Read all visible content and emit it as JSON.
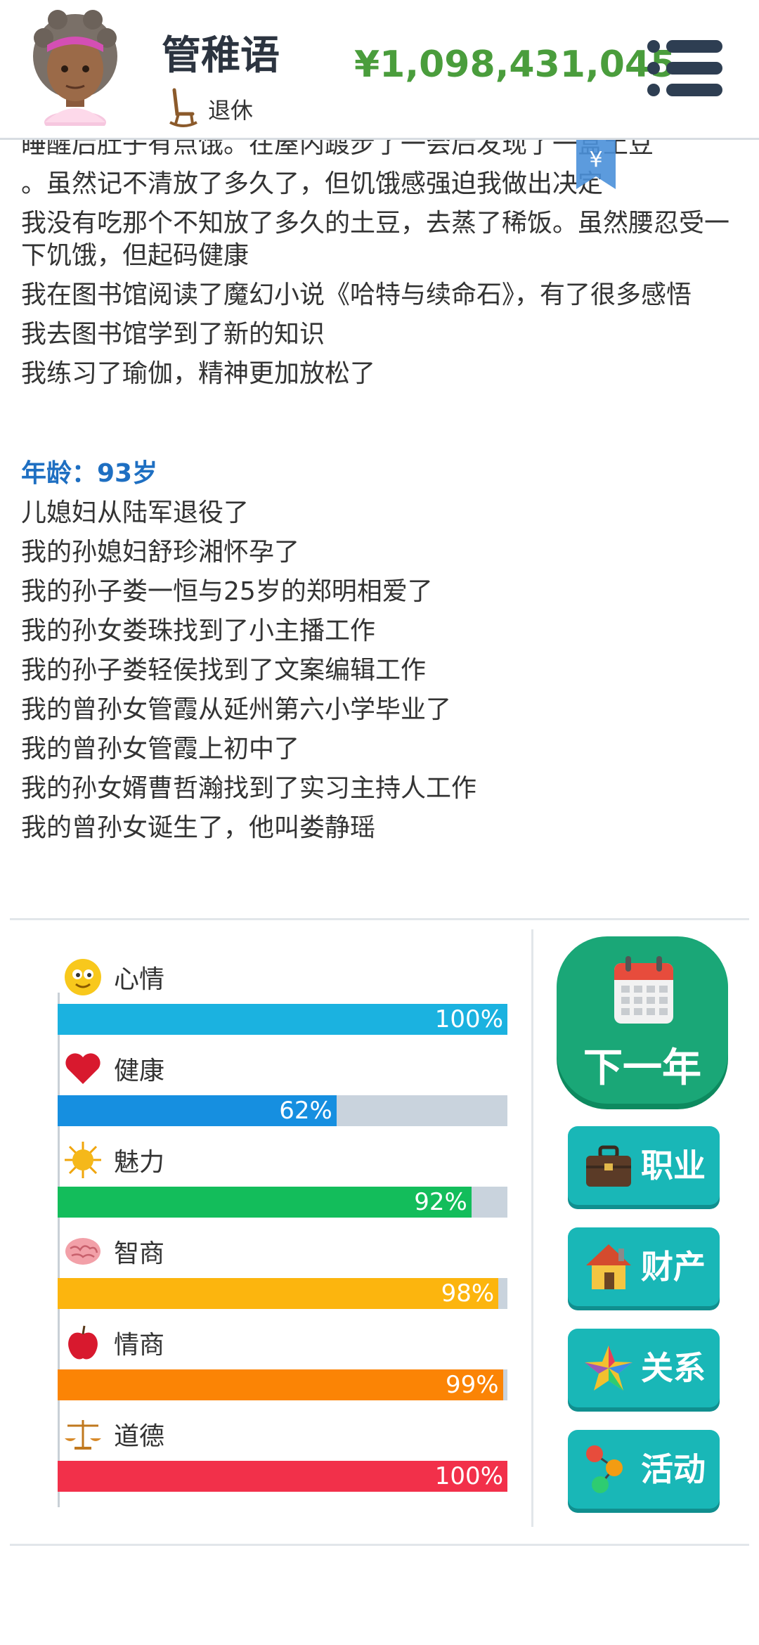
{
  "header": {
    "name": "管稚语",
    "status": "退休",
    "money": "¥1,098,431,045"
  },
  "tip_badge": "¥",
  "log": [
    {
      "text": "睡醒后肚子有点饿。在屋内踱步了一会后发现了一盒土豆"
    },
    {
      "text": "。虽然记不清放了多久了，但饥饿感强迫我做出决定"
    },
    {
      "text": "我没有吃那个不知放了多久的土豆，去蒸了稀饭。虽然腰忍受一下饥饿，但起码健康"
    },
    {
      "text": "我在图书馆阅读了魔幻小说《哈特与续命石》，有了很多感悟"
    },
    {
      "text": "我去图书馆学到了新的知识"
    },
    {
      "text": "我练习了瑜伽，精神更加放松了"
    },
    {
      "text": "年龄：93岁",
      "year": true
    },
    {
      "text": "儿媳妇从陆军退役了"
    },
    {
      "text": "我的孙媳妇舒珍湘怀孕了"
    },
    {
      "text": "我的孙子娄一恒与25岁的郑明相爱了"
    },
    {
      "text": "我的孙女娄珠找到了小主播工作"
    },
    {
      "text": "我的孙子娄轻侯找到了文案编辑工作"
    },
    {
      "text": "我的曾孙女管霞从延州第六小学毕业了"
    },
    {
      "text": "我的曾孙女管霞上初中了"
    },
    {
      "text": "我的孙女婿曹哲瀚找到了实习主持人工作"
    },
    {
      "text": "我的曾孙女诞生了，他叫娄静瑶"
    }
  ],
  "stats": [
    {
      "name": "心情",
      "icon": "smiley-icon",
      "value": 100,
      "label": "100%",
      "color": "#1bb2e0"
    },
    {
      "name": "健康",
      "icon": "heart-icon",
      "value": 62,
      "label": "62%",
      "color": "#168fe0"
    },
    {
      "name": "魅力",
      "icon": "sun-icon",
      "value": 92,
      "label": "92%",
      "color": "#13bd5b"
    },
    {
      "name": "智商",
      "icon": "brain-icon",
      "value": 98,
      "label": "98%",
      "color": "#fcb50e"
    },
    {
      "name": "情商",
      "icon": "apple-icon",
      "value": 99,
      "label": "99%",
      "color": "#fb8405"
    },
    {
      "name": "道德",
      "icon": "scales-icon",
      "value": 100,
      "label": "100%",
      "color": "#f2304a"
    }
  ],
  "actions": {
    "next_year": "下一年",
    "career": "职业",
    "property": "财产",
    "relations": "关系",
    "activities": "活动"
  }
}
